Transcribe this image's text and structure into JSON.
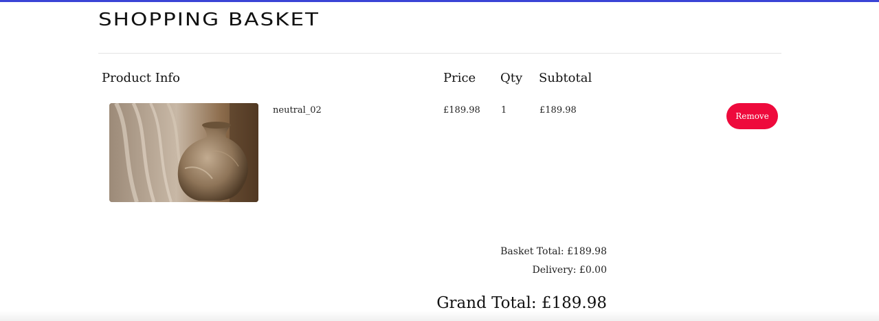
{
  "theme": {
    "top_rule_color": "#3a44d6",
    "remove_button_color": "#ee0a3c"
  },
  "page": {
    "title": "Shopping Basket"
  },
  "table": {
    "headers": {
      "product_info": "Product Info",
      "price": "Price",
      "qty": "Qty",
      "subtotal": "Subtotal"
    },
    "rows": [
      {
        "image_icon": "vase-photo",
        "name": "neutral_02",
        "price": "£189.98",
        "qty": "1",
        "subtotal": "£189.98",
        "remove_label": "Remove"
      }
    ]
  },
  "summary": {
    "basket_total": "Basket Total: £189.98",
    "delivery": "Delivery: £0.00",
    "grand_total": "Grand Total: £189.98"
  }
}
